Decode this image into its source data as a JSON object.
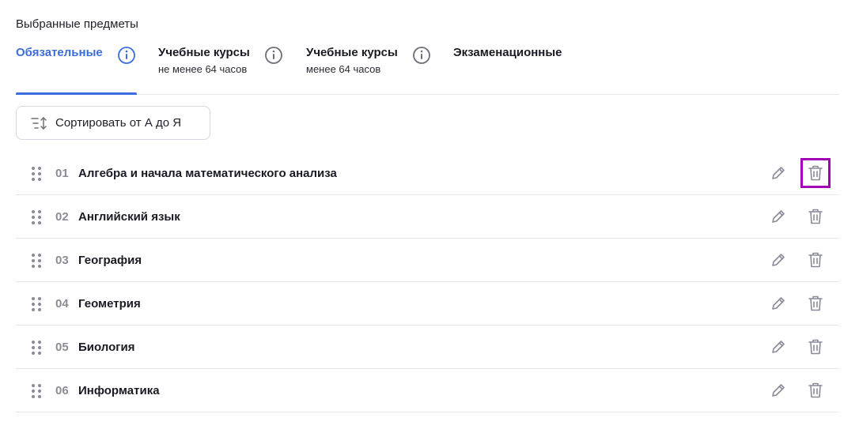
{
  "section": {
    "title": "Выбранные предметы"
  },
  "tabs": [
    {
      "label": "Обязательные",
      "sub": ""
    },
    {
      "label": "Учебные курсы",
      "sub": "не менее 64 часов"
    },
    {
      "label": "Учебные курсы",
      "sub": "менее 64 часов"
    },
    {
      "label": "Экзаменационные",
      "sub": ""
    }
  ],
  "sort": {
    "label": "Сортировать от А до Я"
  },
  "items": [
    {
      "num": "01",
      "name": "Алгебра и начала математического анализа"
    },
    {
      "num": "02",
      "name": "Английский язык"
    },
    {
      "num": "03",
      "name": "География"
    },
    {
      "num": "04",
      "name": "Геометрия"
    },
    {
      "num": "05",
      "name": "Биология"
    },
    {
      "num": "06",
      "name": "Информатика"
    }
  ],
  "colors": {
    "accent": "#3b6de0",
    "highlight": "#a100b5",
    "icon": "#8b8b98"
  },
  "icons": {
    "info": "info-icon",
    "drag": "drag-handle-icon",
    "edit": "pencil-icon",
    "delete": "trash-icon",
    "sort": "sort-icon"
  }
}
